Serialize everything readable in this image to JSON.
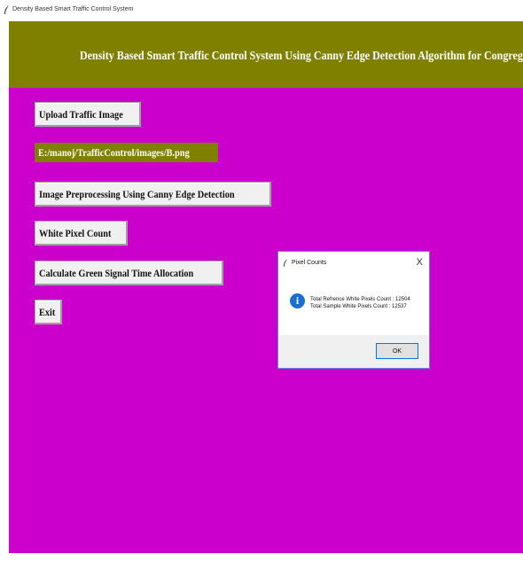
{
  "window": {
    "title": "Density Based Smart Traffic Control System"
  },
  "header": {
    "title": "Density Based Smart Traffic Control System Using Canny Edge Detection Algorithm for Congregating Traffic Information"
  },
  "buttons": {
    "upload": "Upload Traffic Image",
    "preprocess": "Image Preprocessing Using Canny Edge Detection",
    "white_pixel": "White Pixel Count",
    "green_signal": "Calculate Green Signal Time Allocation",
    "exit": "Exit"
  },
  "path_label": "E:/manoj/TrafficControl/images/B.png",
  "dialog": {
    "title": "Pixel Counts",
    "close": "X",
    "icon": "info-icon",
    "line1": "Total Refrence White Pixels Count : 12504",
    "line2": "Total Sample White Pixels Count : 12537",
    "ok_label": "OK"
  },
  "colors": {
    "background": "#cc00cc",
    "header": "#808000",
    "path_label": "#808000",
    "button": "#f0f0f0",
    "info_icon": "#1a6fd0"
  }
}
